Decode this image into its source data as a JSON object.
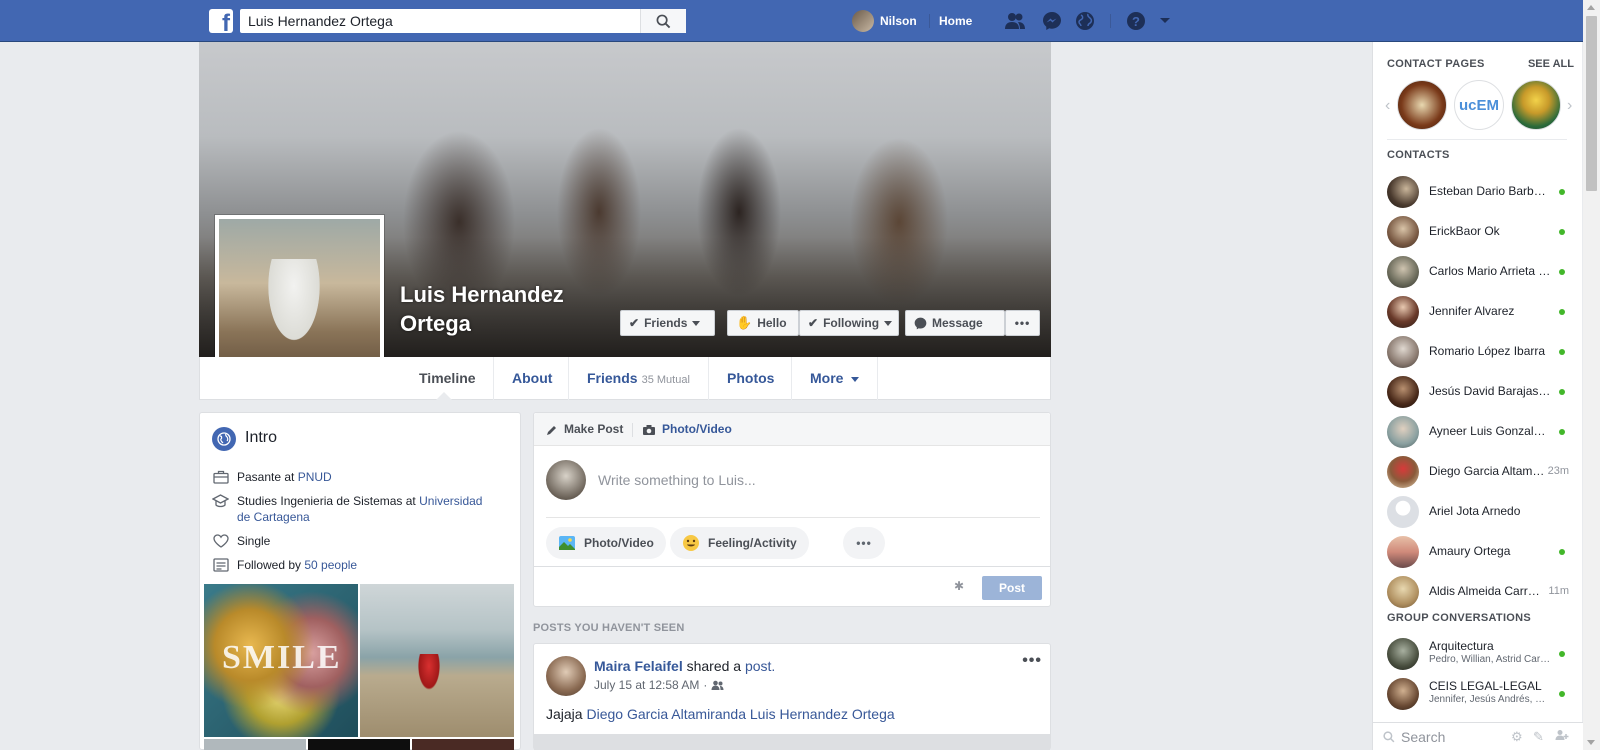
{
  "topbar": {
    "search_value": "Luis Hernandez Ortega",
    "user_name": "Nilson",
    "home_label": "Home"
  },
  "profile": {
    "name": "Luis Hernandez Ortega",
    "buttons": {
      "friends": "Friends",
      "hello": "Hello",
      "following": "Following",
      "message": "Message"
    },
    "tabs": {
      "timeline": "Timeline",
      "about": "About",
      "friends": "Friends",
      "friends_sub": "35 Mutual",
      "photos": "Photos",
      "more": "More"
    }
  },
  "intro": {
    "title": "Intro",
    "work_prefix": "Pasante at ",
    "work_link": "PNUD",
    "study_prefix": "Studies Ingenieria de Sistemas at ",
    "study_link": "Universidad de Cartagena",
    "relationship": "Single",
    "followed_prefix": "Followed by ",
    "followed_link": "50 people"
  },
  "composer": {
    "make_post": "Make Post",
    "photo_video_tab": "Photo/Video",
    "placeholder": "Write something to Luis...",
    "photo_video_btn": "Photo/Video",
    "feeling_btn": "Feeling/Activity",
    "post_btn": "Post"
  },
  "feed": {
    "section_header": "POSTS YOU HAVEN'T SEEN",
    "post": {
      "author": "Maira Felaifel",
      "action": " shared a ",
      "action_link": "post.",
      "time": "July 15 at 12:58 AM",
      "text_prefix": "Jajaja ",
      "mention1": "Diego Garcia Altamiranda",
      "mention2": "Luis Hernandez Ortega"
    }
  },
  "sidebar": {
    "contact_pages_header": "CONTACT PAGES",
    "see_all": "SEE ALL",
    "page_2_label": "ucEM",
    "contacts_header": "CONTACTS",
    "contacts": [
      {
        "name": "Esteban Dario Barbo…",
        "status": "online"
      },
      {
        "name": "ErickBaor Ok",
        "status": "online"
      },
      {
        "name": "Carlos Mario Arrieta …",
        "status": "online"
      },
      {
        "name": "Jennifer Alvarez",
        "status": "online"
      },
      {
        "name": "Romario López Ibarra",
        "status": "online"
      },
      {
        "name": "Jesús David Barajas …",
        "status": "online"
      },
      {
        "name": "Ayneer Luis Gonzale…",
        "status": "online"
      },
      {
        "name": "Diego Garcia Altam…",
        "time": "23m"
      },
      {
        "name": "Ariel Jota Arnedo",
        "status": "none"
      },
      {
        "name": "Amaury Ortega",
        "status": "online"
      },
      {
        "name": "Aldis Almeida Carr…",
        "time": "11m"
      }
    ],
    "group_header": "GROUP CONVERSATIONS",
    "groups": [
      {
        "name": "Arquitectura",
        "members": "Pedro, Willian, Astrid Caro…"
      },
      {
        "name": "CEIS LEGAL-LEGAL",
        "members": "Jennifer, Jesús Andrés, Er…"
      }
    ],
    "search_placeholder": "Search"
  },
  "colors": {
    "brand": "#4267b2",
    "link": "#365899",
    "online": "#42b72a"
  }
}
